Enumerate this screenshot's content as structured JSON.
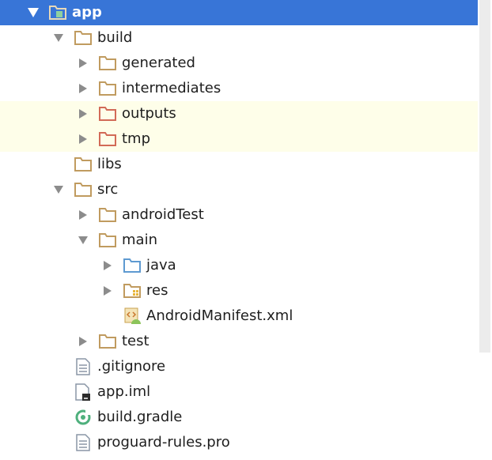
{
  "tree": {
    "app": "app",
    "build": "build",
    "generated": "generated",
    "intermediates": "intermediates",
    "outputs": "outputs",
    "tmp": "tmp",
    "libs": "libs",
    "src": "src",
    "androidTest": "androidTest",
    "main": "main",
    "java": "java",
    "res": "res",
    "manifest": "AndroidManifest.xml",
    "test": "test",
    "gitignore": ".gitignore",
    "app_iml": "app.iml",
    "build_gradle": "build.gradle",
    "proguard": "proguard-rules.pro"
  },
  "colors": {
    "selection": "#3875d7",
    "highlight": "#fefee9",
    "folder": "#c09b5f",
    "excluded_folder": "#d26a57",
    "source_folder": "#5e9ad1"
  },
  "icons": {
    "module": "module-folder-icon",
    "folder": "folder-icon",
    "excluded": "excluded-folder-icon",
    "source": "source-folder-icon",
    "resources": "resources-folder-icon",
    "manifest": "android-manifest-icon",
    "text": "text-file-icon",
    "iml": "iml-file-icon",
    "gradle": "gradle-file-icon"
  }
}
